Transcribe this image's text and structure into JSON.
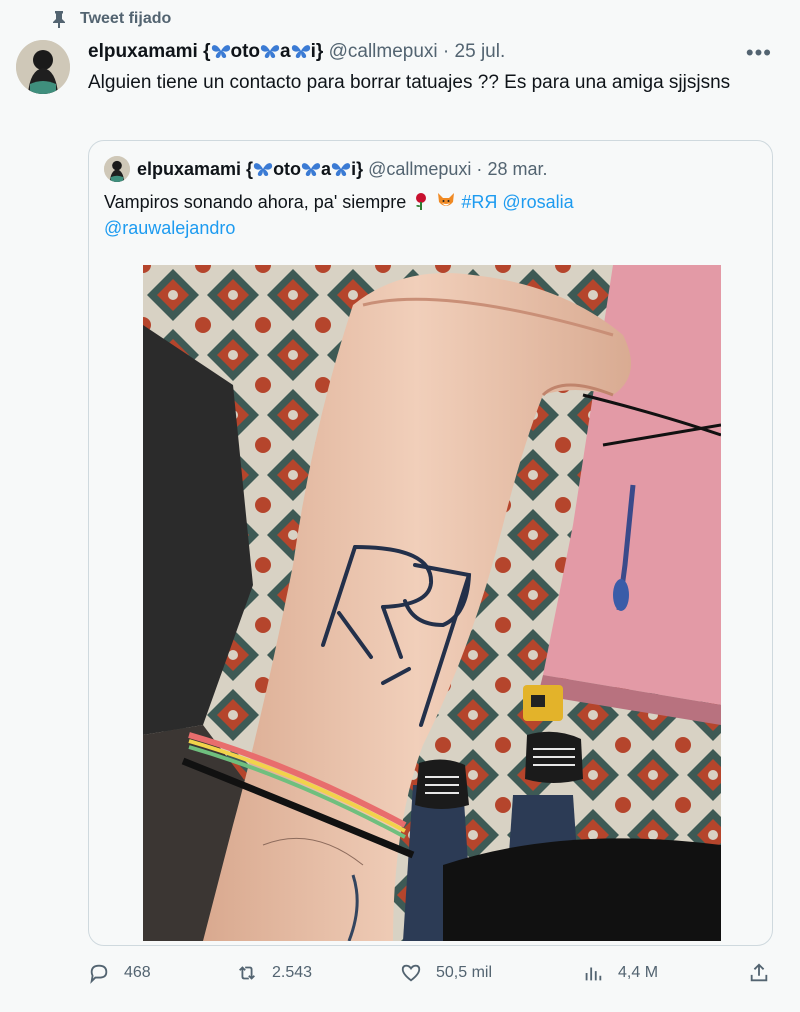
{
  "pinned": {
    "label": "Tweet fijado",
    "icon": "pin-icon"
  },
  "tweet": {
    "author_name_prefix": "elpuxamami {",
    "author_name_parts": [
      "oto",
      "a",
      "i}"
    ],
    "handle": "@callmepuxi",
    "separator": "·",
    "date": "25 jul.",
    "text": "Alguien tiene un contacto para borrar tatuajes ?? Es para una amiga sjjsjsns",
    "more_icon": "more-icon"
  },
  "quoted": {
    "author_name_prefix": "elpuxamami {",
    "author_name_parts": [
      "oto",
      "a",
      "i}"
    ],
    "handle": "@callmepuxi",
    "separator": "·",
    "date": "28 mar.",
    "text_main": "Vampiros sonando ahora, pa' siempre",
    "hashtag": "#RЯ",
    "mention1": "@rosalia",
    "mention2": "@rauwalejandro",
    "photo_alt": "RЯ"
  },
  "actions": {
    "replies": "468",
    "retweets": "2.543",
    "likes": "50,5 mil",
    "views": "4,4 M"
  },
  "colors": {
    "text": "#0f1419",
    "secondary": "#536471",
    "link": "#1d9bf0",
    "butterfly": "#3b7bd4",
    "background": "#f7f9f9",
    "border": "#cfd9de"
  }
}
